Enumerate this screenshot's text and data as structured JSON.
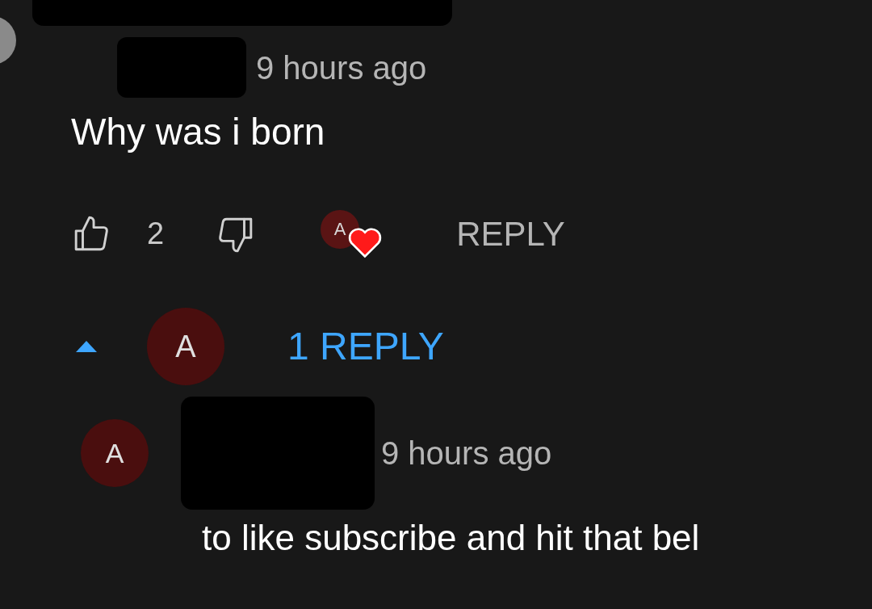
{
  "comment": {
    "time": "9 hours ago",
    "text": "Why was i born",
    "likes": "2",
    "hearted": true,
    "heart_avatar_letter": "A",
    "reply_button": "REPLY"
  },
  "replies_toggle": {
    "expanded": true,
    "avatar_letter": "A",
    "label": "1 REPLY"
  },
  "replies": [
    {
      "avatar_letter": "A",
      "time": "9 hours ago",
      "text": "to like subscribe and hit that bel"
    }
  ]
}
